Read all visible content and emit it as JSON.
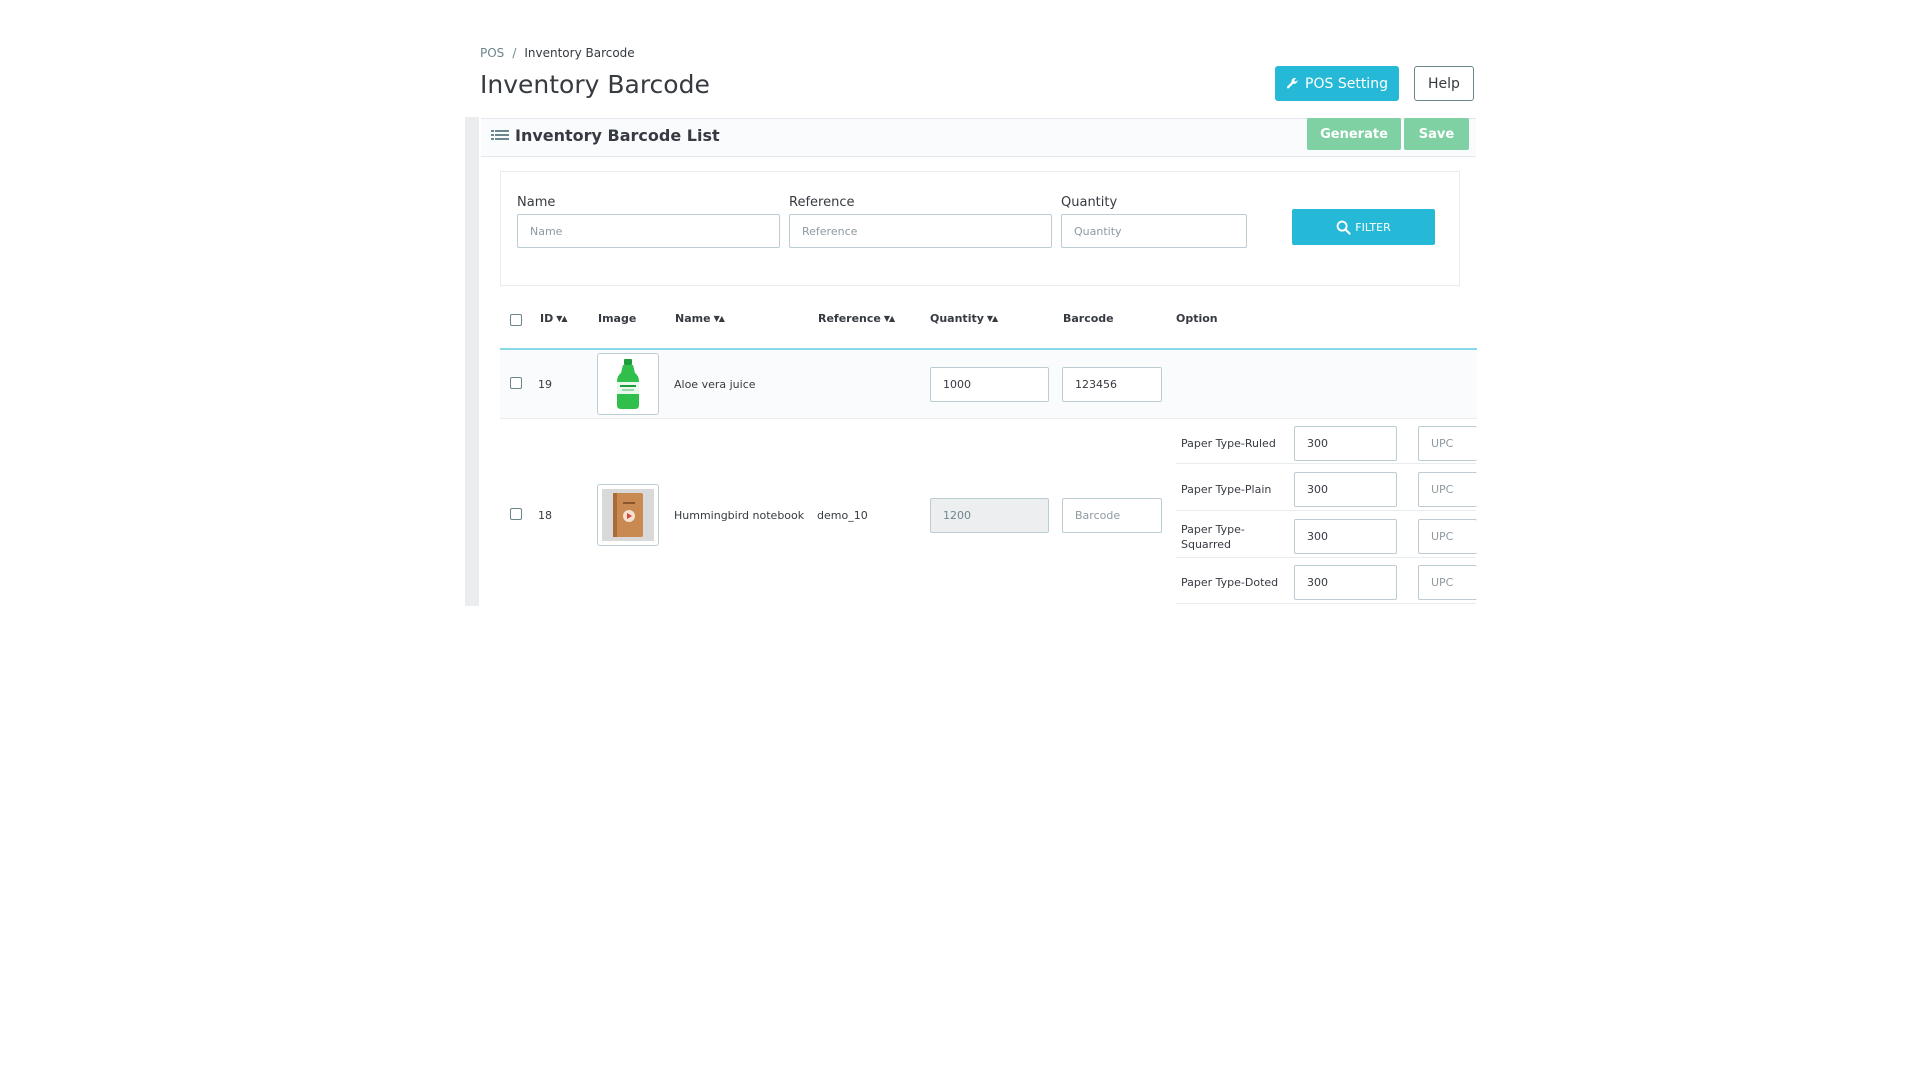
{
  "breadcrumb": {
    "root": "POS",
    "separator": "/",
    "current": "Inventory Barcode"
  },
  "page_title": "Inventory Barcode",
  "header_buttons": {
    "pos_setting": "POS Setting",
    "help": "Help"
  },
  "panel": {
    "title": "Inventory Barcode List",
    "generate": "Generate",
    "save": "Save"
  },
  "filter": {
    "name_label": "Name",
    "name_placeholder": "Name",
    "reference_label": "Reference",
    "reference_placeholder": "Reference",
    "quantity_label": "Quantity",
    "quantity_placeholder": "Quantity",
    "button": "FILTER"
  },
  "table": {
    "headers": {
      "id": "ID",
      "image": "Image",
      "name": "Name",
      "reference": "Reference",
      "quantity": "Quantity",
      "barcode": "Barcode",
      "option": "Option"
    },
    "rows": [
      {
        "id": "19",
        "name": "Aloe vera juice",
        "reference": "",
        "quantity": "1000",
        "barcode": "123456"
      },
      {
        "id": "18",
        "name": "Hummingbird notebook",
        "reference": "demo_10",
        "quantity": "1200",
        "barcode_placeholder": "Barcode",
        "options": [
          {
            "label": "Paper Type-Ruled",
            "value": "300",
            "upc_placeholder": "UPC"
          },
          {
            "label": "Paper Type-Plain",
            "value": "300",
            "upc_placeholder": "UPC"
          },
          {
            "label": "Paper Type-Squarred",
            "value": "300",
            "upc_placeholder": "UPC"
          },
          {
            "label": "Paper Type-Doted",
            "value": "300",
            "upc_placeholder": "UPC"
          }
        ]
      }
    ]
  },
  "colors": {
    "primary": "#25b9d7",
    "success_light": "#7fd1a3",
    "text": "#363a41",
    "muted": "#6c868e"
  }
}
